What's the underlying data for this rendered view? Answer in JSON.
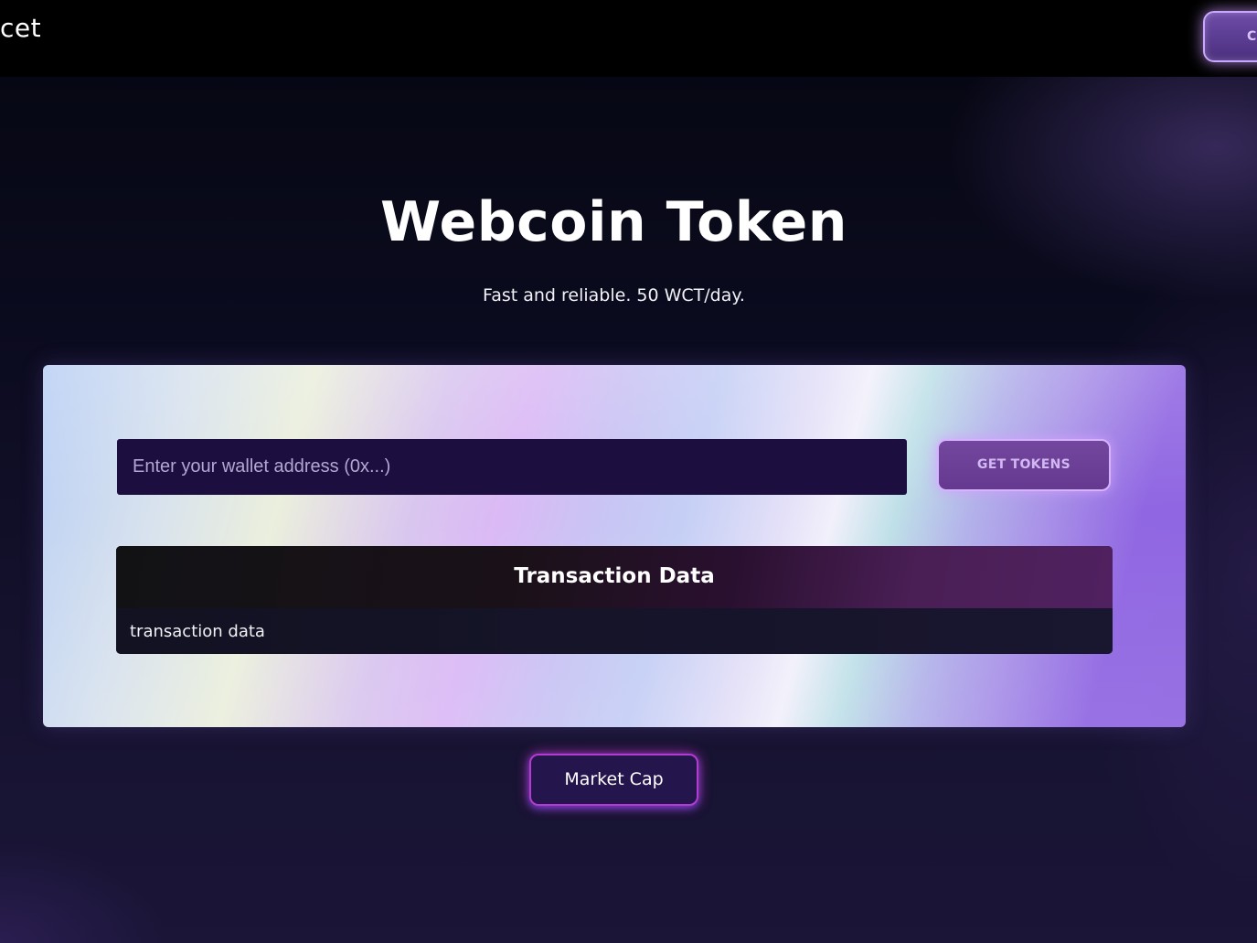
{
  "header": {
    "brand": "cet",
    "connect_label": "C"
  },
  "hero": {
    "title": "Webcoin Token",
    "subtitle": "Fast and reliable. 50 WCT/day."
  },
  "faucet": {
    "wallet_placeholder": "Enter your wallet address (0x...)",
    "wallet_value": "",
    "get_tokens_label": "GET TOKENS"
  },
  "transaction": {
    "title": "Transaction Data",
    "body": "transaction data"
  },
  "footer": {
    "market_cap_label": "Market Cap"
  },
  "colors": {
    "background": "#0a0a1c",
    "topbar": "#000000",
    "input_bg": "#1c0f3f",
    "button_border": "#d6b3ff",
    "market_border": "#b23bd0"
  }
}
